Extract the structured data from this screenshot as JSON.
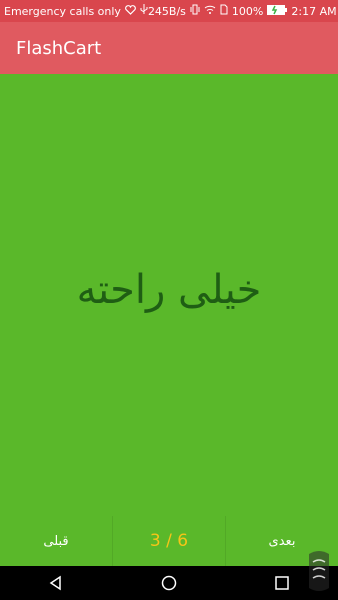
{
  "status_bar": {
    "carrier": "Emergency calls only",
    "speed": "245B/s",
    "battery_pct": "100%",
    "time": "2:17 AM"
  },
  "app_bar": {
    "title": "FlashCart"
  },
  "card": {
    "word": "خیلی راحته"
  },
  "nav": {
    "prev_label": "قبلی",
    "counter": "3 / 6",
    "next_label": "بعدی"
  },
  "colors": {
    "status_bar": "#d9464d",
    "app_bar": "#e05a60",
    "background": "#5ab82a",
    "word": "#1f5e14",
    "counter": "#f5c518"
  }
}
